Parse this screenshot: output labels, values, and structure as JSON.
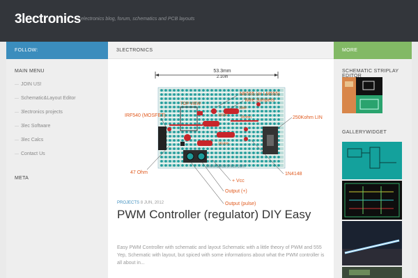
{
  "header": {
    "site_title": "3lectronics",
    "tagline": "electronics blog, forum, schematics and PCB layouts"
  },
  "left": {
    "follow_label": "FOLLOW:",
    "main_menu_title": "MAIN MENU",
    "menu_items": [
      {
        "label": "JOIN US!"
      },
      {
        "label": "Schematic&Layout Editor"
      },
      {
        "label": "3lectronics projects"
      },
      {
        "label": "3lec Software"
      },
      {
        "label": "3lec Calcs"
      },
      {
        "label": "Contact Us"
      }
    ],
    "meta_title": "META"
  },
  "main": {
    "header_label": "3LECTRONICS",
    "post": {
      "category": "PROJECTS",
      "date": "8 JUN, 2012",
      "title": "PWM Controller (regulator) DIY Easy",
      "excerpt": "Easy PWM Controller with schematic and layout Schematic with a little theory of PWM and 555 Yep, Schematic with layout, but spiced with some informations about what the PWM controller is all about in..."
    },
    "figure": {
      "dim_width": "53.3mm",
      "dim_width_in": "2.10in",
      "labels": {
        "ne555": "NE555 (or LM555)",
        "wire_jumpers": "Wire Jumpers",
        "irf540": "IRF540 (MOSFET)",
        "pot": "250Kohm LIN",
        "r47": "47 Ohm",
        "d1n4148": "1N4148",
        "vcc": "+ Vcc",
        "out_plus": "Output (+)",
        "out_pulse": "Output (pulse)",
        "watermark": "www.3lectronics.com",
        "top_view": "TOP VIEW",
        "r1": "100nF",
        "r2": "10nF",
        "r3": "1Kohm",
        "r4": "1Kohm"
      }
    }
  },
  "right": {
    "more_label": "MORE",
    "schematic_title": "SCHEMATIC STRIPLAY EDITOR",
    "gallery_title": "GALLERYWIDGET"
  },
  "colors": {
    "header_bg": "#33363b",
    "follow_bar": "#3b8dbd",
    "more_bar": "#82b965",
    "pcb_teal": "#1d9b9a",
    "copper_red": "#c8252a",
    "label_orange": "#e0591d"
  }
}
